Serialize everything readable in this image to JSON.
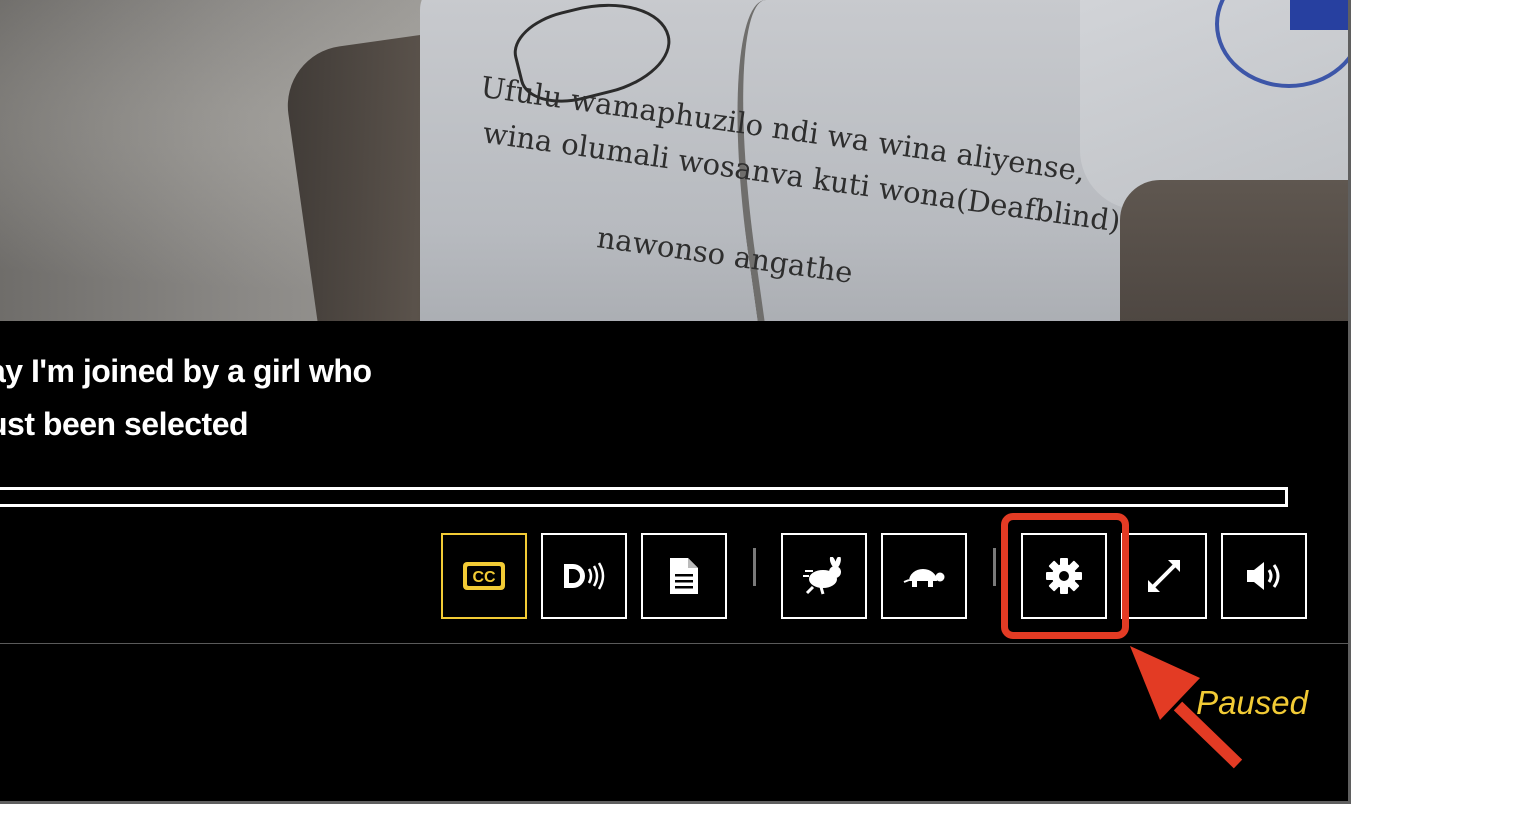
{
  "video": {
    "shirt_text": [
      "Ufulu wamaphuzilo ndi wa wina aliyense,",
      "wina olumali wosanva kuti wona(Deafblind)",
      "nawonso angathe"
    ]
  },
  "captions": {
    "line1": "ay I'm joined by a girl who",
    "line2": "ust been selected"
  },
  "progress": {
    "value_percent": 0
  },
  "controls": [
    {
      "name": "captions-button",
      "icon": "closed-captions-icon",
      "active": true
    },
    {
      "name": "audio-description-button",
      "icon": "audio-description-icon",
      "active": false
    },
    {
      "name": "transcript-button",
      "icon": "document-icon",
      "active": false
    },
    {
      "name": "faster-button",
      "icon": "rabbit-icon",
      "active": false
    },
    {
      "name": "slower-button",
      "icon": "turtle-icon",
      "active": false
    },
    {
      "name": "settings-button",
      "icon": "gear-icon",
      "active": false
    },
    {
      "name": "fullscreen-button",
      "icon": "expand-icon",
      "active": false
    },
    {
      "name": "volume-button",
      "icon": "speaker-icon",
      "active": false
    }
  ],
  "status": {
    "text": "Paused"
  },
  "colors": {
    "accent": "#f2cb35",
    "highlight": "#e33b24"
  }
}
